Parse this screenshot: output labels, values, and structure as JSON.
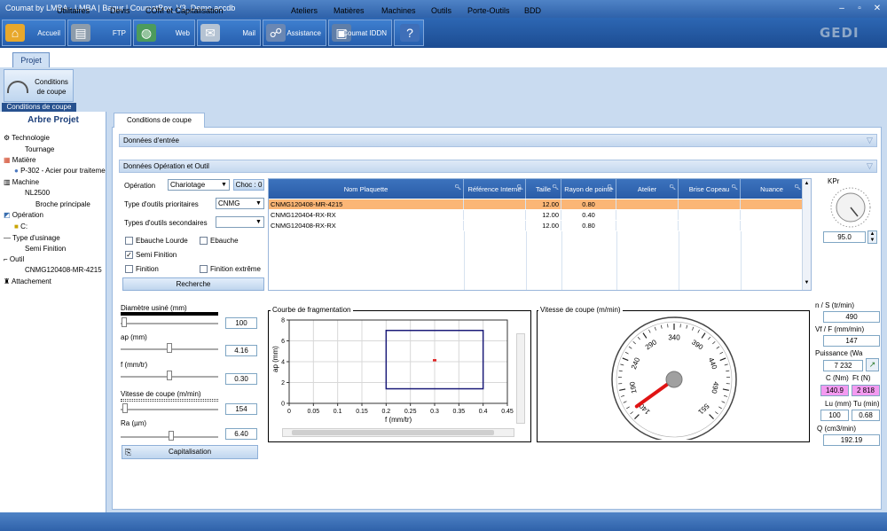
{
  "window": {
    "title": "Coumat by LMBA - LMBA | Bagur | CoumatBox_V3_Demo.accdb"
  },
  "toolbar": {
    "buttons": [
      {
        "label": "Accueil",
        "icon": "home-icon"
      },
      {
        "label": "FTP",
        "icon": "server-icon"
      },
      {
        "label": "Web",
        "icon": "globe-icon"
      },
      {
        "label": "Mail",
        "icon": "mail-icon"
      },
      {
        "label": "Assistance",
        "icon": "assistance-icon"
      },
      {
        "label": "Coumat IDDN",
        "icon": "document-icon"
      },
      {
        "label": "",
        "icon": "help-icon"
      }
    ],
    "brand": "GEDI"
  },
  "menu": {
    "items": [
      "Projet",
      "Utilitaires",
      "Devis",
      "COM et Capitalisation",
      "Ateliers",
      "Matières",
      "Machines",
      "Outils",
      "Porte-Outils",
      "BDD"
    ],
    "active": "Projet"
  },
  "ribbon": {
    "button_label": "Conditions de coupe",
    "group_label": "Conditions de coupe"
  },
  "tree": {
    "title": "Arbre Projet",
    "items": {
      "technologie": "Technologie",
      "tournage": "Tournage",
      "matiere": "Matière",
      "p302": "P-302 - Acier pour traiteme",
      "machine": "Machine",
      "nl2500": "NL2500",
      "broche": "Broche principale",
      "operation": "Opération",
      "op_value": "C:",
      "type_usinage": "Type d'usinage",
      "semi": "Semi Finition",
      "outil": "Outil",
      "outil_value": "CNMG120408-MR-4215",
      "attachement": "Attachement"
    }
  },
  "content": {
    "tab": "Conditions de coupe",
    "section_entree": "Données d'entrée",
    "section_operation": "Données Opération et Outil"
  },
  "form": {
    "operation_label": "Opération",
    "operation_value": "Chariotage",
    "choc_label": "Choc : 0",
    "type_outils_label": "Type d'outils prioritaires",
    "type_outils_value": "CNMG",
    "types_secondaires_label": "Types d'outils secondaires",
    "types_secondaires_value": "",
    "checkboxes": [
      {
        "label": "Ebauche Lourde",
        "checked": false
      },
      {
        "label": "Ebauche",
        "checked": false
      },
      {
        "label": "Semi Finition",
        "checked": true
      },
      {
        "label": "Finition",
        "checked": false
      },
      {
        "label": "Finition extrême",
        "checked": false
      }
    ],
    "recherche_label": "Recherche"
  },
  "grid": {
    "columns": [
      "Nom Plaquette",
      "Référence Interne",
      "Taille",
      "Rayon de pointe",
      "Atelier",
      "Brise Copeau",
      "Nuance"
    ],
    "rows": [
      {
        "nom": "CNMG120408-MR-4215",
        "ref": "",
        "taille": "12.00",
        "rayon": "0.80",
        "atelier": "",
        "brise": "",
        "nuance": ""
      },
      {
        "nom": "CNMG120404-RX-RX",
        "ref": "",
        "taille": "12.00",
        "rayon": "0.40",
        "atelier": "",
        "brise": "",
        "nuance": ""
      },
      {
        "nom": "CNMG120408-RX-RX",
        "ref": "",
        "taille": "12.00",
        "rayon": "0.80",
        "atelier": "",
        "brise": "",
        "nuance": ""
      }
    ],
    "selected_row": 0,
    "selected_color": "#fbb676"
  },
  "kpr": {
    "label": "KPr",
    "value": "95.0"
  },
  "params": {
    "diametre_label": "Diamètre usiné (mm)",
    "diametre_value": "100",
    "ap_label": "ap (mm)",
    "ap_value": "4.16",
    "f_label": "f (mm/tr)",
    "f_value": "0.30",
    "vc_label": "Vitesse de coupe (m/min)",
    "vc_value": "154",
    "ra_label": "Ra (µm)",
    "ra_value": "6.40",
    "capitalisation_label": "Capitalisation"
  },
  "frag_chart": {
    "title": "Courbe de fragmentation",
    "xlabel": "f (mm/tr)",
    "ylabel": "ap (mm)"
  },
  "chart_data": {
    "type": "scatter",
    "title": "Courbe de fragmentation",
    "xlabel": "f (mm/tr)",
    "ylabel": "ap (mm)",
    "xlim": [
      0,
      0.45
    ],
    "ylim": [
      0,
      8
    ],
    "x_ticks": [
      "0",
      "0.05",
      "0.1",
      "0.15",
      "0.2",
      "0.25",
      "0.3",
      "0.35",
      "0.4",
      "0.45"
    ],
    "y_ticks": [
      "0",
      "2",
      "4",
      "6",
      "8"
    ],
    "grid": true,
    "rectangle": {
      "x0": 0.2,
      "x1": 0.4,
      "y0": 1.4,
      "y1": 7.0,
      "color": "#1c1c7a"
    },
    "point": {
      "x": 0.3,
      "y": 4.16,
      "color": "#e02020"
    }
  },
  "gauge": {
    "title": "Vitesse de coupe (m/min)",
    "ticks": [
      "140",
      "190",
      "240",
      "290",
      "340",
      "390",
      "440",
      "490",
      "551"
    ],
    "value": 154,
    "min": 140,
    "max": 551,
    "needle_color": "#e01414"
  },
  "results": {
    "n_label": "n / S (tr/min)",
    "n_value": "490",
    "vf_label": "Vf / F (mm/min)",
    "vf_value": "147",
    "puissance_label": "Puissance (Wa",
    "puissance_value": "7 232",
    "c_label": "C (Nm)",
    "c_value": "140.9",
    "ft_label": "Ft (N)",
    "ft_value": "2 818",
    "lu_label": "Lu (mm)",
    "lu_value": "100",
    "tu_label": "Tu (min)",
    "tu_value": "0.68",
    "q_label": "Q (cm3/min)",
    "q_value": "192.19",
    "highlight_color": "#f39af0"
  }
}
